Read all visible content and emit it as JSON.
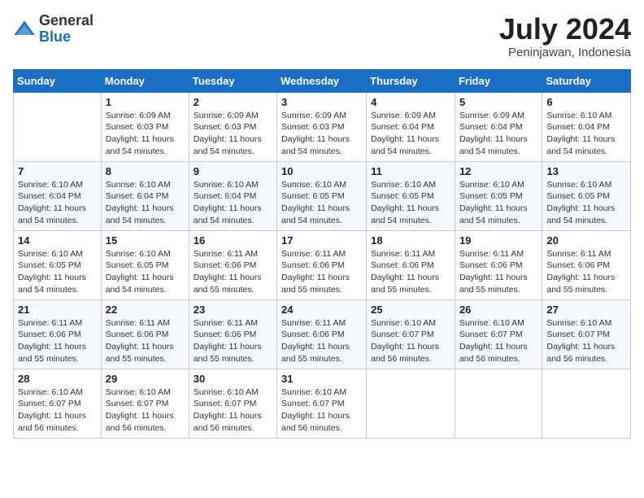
{
  "header": {
    "logo": {
      "general": "General",
      "blue": "Blue"
    },
    "title": "July 2024",
    "location": "Peninjawan, Indonesia"
  },
  "days_of_week": [
    "Sunday",
    "Monday",
    "Tuesday",
    "Wednesday",
    "Thursday",
    "Friday",
    "Saturday"
  ],
  "weeks": [
    [
      {
        "day": "",
        "sunrise": "",
        "sunset": "",
        "daylight": ""
      },
      {
        "day": "1",
        "sunrise": "6:09 AM",
        "sunset": "6:03 PM",
        "hours": "11 hours",
        "minutes": "and 54 minutes."
      },
      {
        "day": "2",
        "sunrise": "6:09 AM",
        "sunset": "6:03 PM",
        "hours": "11 hours",
        "minutes": "and 54 minutes."
      },
      {
        "day": "3",
        "sunrise": "6:09 AM",
        "sunset": "6:03 PM",
        "hours": "11 hours",
        "minutes": "and 54 minutes."
      },
      {
        "day": "4",
        "sunrise": "6:09 AM",
        "sunset": "6:04 PM",
        "hours": "11 hours",
        "minutes": "and 54 minutes."
      },
      {
        "day": "5",
        "sunrise": "6:09 AM",
        "sunset": "6:04 PM",
        "hours": "11 hours",
        "minutes": "and 54 minutes."
      },
      {
        "day": "6",
        "sunrise": "6:10 AM",
        "sunset": "6:04 PM",
        "hours": "11 hours",
        "minutes": "and 54 minutes."
      }
    ],
    [
      {
        "day": "7",
        "sunrise": "6:10 AM",
        "sunset": "6:04 PM",
        "hours": "11 hours",
        "minutes": "and 54 minutes."
      },
      {
        "day": "8",
        "sunrise": "6:10 AM",
        "sunset": "6:04 PM",
        "hours": "11 hours",
        "minutes": "and 54 minutes."
      },
      {
        "day": "9",
        "sunrise": "6:10 AM",
        "sunset": "6:04 PM",
        "hours": "11 hours",
        "minutes": "and 54 minutes."
      },
      {
        "day": "10",
        "sunrise": "6:10 AM",
        "sunset": "6:05 PM",
        "hours": "11 hours",
        "minutes": "and 54 minutes."
      },
      {
        "day": "11",
        "sunrise": "6:10 AM",
        "sunset": "6:05 PM",
        "hours": "11 hours",
        "minutes": "and 54 minutes."
      },
      {
        "day": "12",
        "sunrise": "6:10 AM",
        "sunset": "6:05 PM",
        "hours": "11 hours",
        "minutes": "and 54 minutes."
      },
      {
        "day": "13",
        "sunrise": "6:10 AM",
        "sunset": "6:05 PM",
        "hours": "11 hours",
        "minutes": "and 54 minutes."
      }
    ],
    [
      {
        "day": "14",
        "sunrise": "6:10 AM",
        "sunset": "6:05 PM",
        "hours": "11 hours",
        "minutes": "and 54 minutes."
      },
      {
        "day": "15",
        "sunrise": "6:10 AM",
        "sunset": "6:05 PM",
        "hours": "11 hours",
        "minutes": "and 54 minutes."
      },
      {
        "day": "16",
        "sunrise": "6:11 AM",
        "sunset": "6:06 PM",
        "hours": "11 hours",
        "minutes": "and 55 minutes."
      },
      {
        "day": "17",
        "sunrise": "6:11 AM",
        "sunset": "6:06 PM",
        "hours": "11 hours",
        "minutes": "and 55 minutes."
      },
      {
        "day": "18",
        "sunrise": "6:11 AM",
        "sunset": "6:06 PM",
        "hours": "11 hours",
        "minutes": "and 55 minutes."
      },
      {
        "day": "19",
        "sunrise": "6:11 AM",
        "sunset": "6:06 PM",
        "hours": "11 hours",
        "minutes": "and 55 minutes."
      },
      {
        "day": "20",
        "sunrise": "6:11 AM",
        "sunset": "6:06 PM",
        "hours": "11 hours",
        "minutes": "and 55 minutes."
      }
    ],
    [
      {
        "day": "21",
        "sunrise": "6:11 AM",
        "sunset": "6:06 PM",
        "hours": "11 hours",
        "minutes": "and 55 minutes."
      },
      {
        "day": "22",
        "sunrise": "6:11 AM",
        "sunset": "6:06 PM",
        "hours": "11 hours",
        "minutes": "and 55 minutes."
      },
      {
        "day": "23",
        "sunrise": "6:11 AM",
        "sunset": "6:06 PM",
        "hours": "11 hours",
        "minutes": "and 55 minutes."
      },
      {
        "day": "24",
        "sunrise": "6:11 AM",
        "sunset": "6:06 PM",
        "hours": "11 hours",
        "minutes": "and 55 minutes."
      },
      {
        "day": "25",
        "sunrise": "6:10 AM",
        "sunset": "6:07 PM",
        "hours": "11 hours",
        "minutes": "and 56 minutes."
      },
      {
        "day": "26",
        "sunrise": "6:10 AM",
        "sunset": "6:07 PM",
        "hours": "11 hours",
        "minutes": "and 56 minutes."
      },
      {
        "day": "27",
        "sunrise": "6:10 AM",
        "sunset": "6:07 PM",
        "hours": "11 hours",
        "minutes": "and 56 minutes."
      }
    ],
    [
      {
        "day": "28",
        "sunrise": "6:10 AM",
        "sunset": "6:07 PM",
        "hours": "11 hours",
        "minutes": "and 56 minutes."
      },
      {
        "day": "29",
        "sunrise": "6:10 AM",
        "sunset": "6:07 PM",
        "hours": "11 hours",
        "minutes": "and 56 minutes."
      },
      {
        "day": "30",
        "sunrise": "6:10 AM",
        "sunset": "6:07 PM",
        "hours": "11 hours",
        "minutes": "and 56 minutes."
      },
      {
        "day": "31",
        "sunrise": "6:10 AM",
        "sunset": "6:07 PM",
        "hours": "11 hours",
        "minutes": "and 56 minutes."
      },
      {
        "day": "",
        "sunrise": "",
        "sunset": "",
        "hours": "",
        "minutes": ""
      },
      {
        "day": "",
        "sunrise": "",
        "sunset": "",
        "hours": "",
        "minutes": ""
      },
      {
        "day": "",
        "sunrise": "",
        "sunset": "",
        "hours": "",
        "minutes": ""
      }
    ]
  ],
  "labels": {
    "sunrise_prefix": "Sunrise: ",
    "sunset_prefix": "Sunset: ",
    "daylight_prefix": "Daylight: "
  }
}
